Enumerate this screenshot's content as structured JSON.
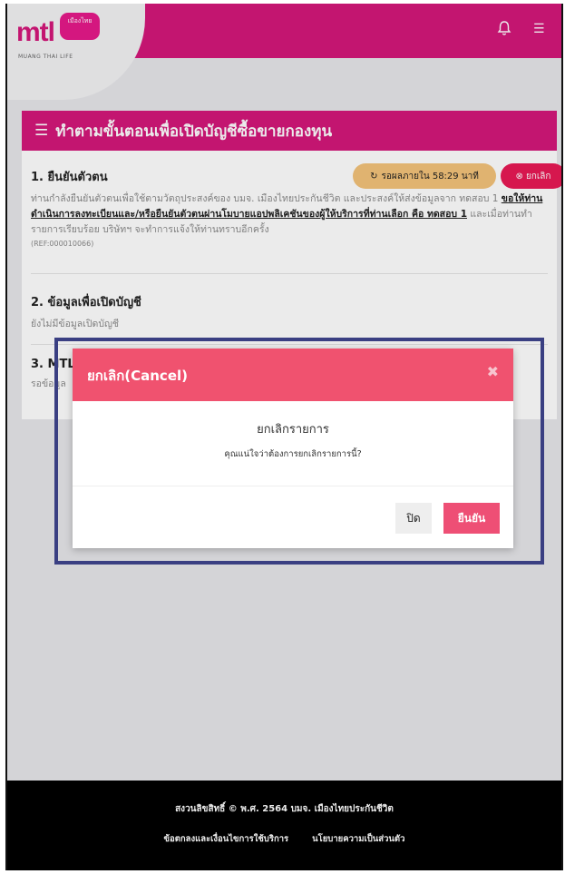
{
  "header": {
    "logo_text": "mtl",
    "logo_badge": "เมืองไทย",
    "logo_subtitle": "MUANG THAI LIFE",
    "colors": {
      "brand": "#d4177a"
    }
  },
  "card": {
    "title": "ทำตามขั้นตอนเพื่อเปิดบัญชีซื้อขายกองทุน",
    "steps": [
      {
        "title": "1. ยืนยันตัวตน",
        "wait_label": "รอผลภายใน 58:29 นาที",
        "cancel_label": "ยกเลิก",
        "desc_part1": "ท่านกำลังยืนยันตัวตนเพื่อใช้ตามวัตถุประสงค์ของ บมจ. เมืองไทยประกันชีวิต และประสงค์ให้ส่งข้อมูลจาก ทดสอบ 1 ",
        "desc_link": "ขอให้ท่านดำเนินการลงทะเบียนและ/หรือยืนยันตัวตนผ่านโมบายแอปพลิเคชันของผู้ให้บริการที่ท่านเลือก คือ ทดสอบ 1",
        "desc_part2": " และเมื่อท่านทำรายการเรียบร้อย บริษัทฯ จะทำการแจ้งให้ท่านทราบอีกครั้ง",
        "ref": "(REF:000010066)"
      },
      {
        "title": "2. ข้อมูลเพื่อเปิดบัญชี",
        "desc": "ยังไม่มีข้อมูลเปิดบัญชี"
      },
      {
        "title": "3. MTL",
        "desc": "รอข้อมูล"
      }
    ]
  },
  "modal": {
    "title": "ยกเลิก(Cancel)",
    "heading": "ยกเลิกรายการ",
    "message": "คุณแน่ใจว่าต้องการยกเลิกรายการนี้?",
    "close_label": "ปิด",
    "confirm_label": "ยืนยัน"
  },
  "footer": {
    "copyright": "สงวนลิขสิทธิ์ © พ.ศ. 2564 บมจ. เมืองไทยประกันชีวิต",
    "links": [
      "ข้อตกลงและเงื่อนไขการใช้บริการ",
      "นโยบายความเป็นส่วนตัว"
    ]
  }
}
